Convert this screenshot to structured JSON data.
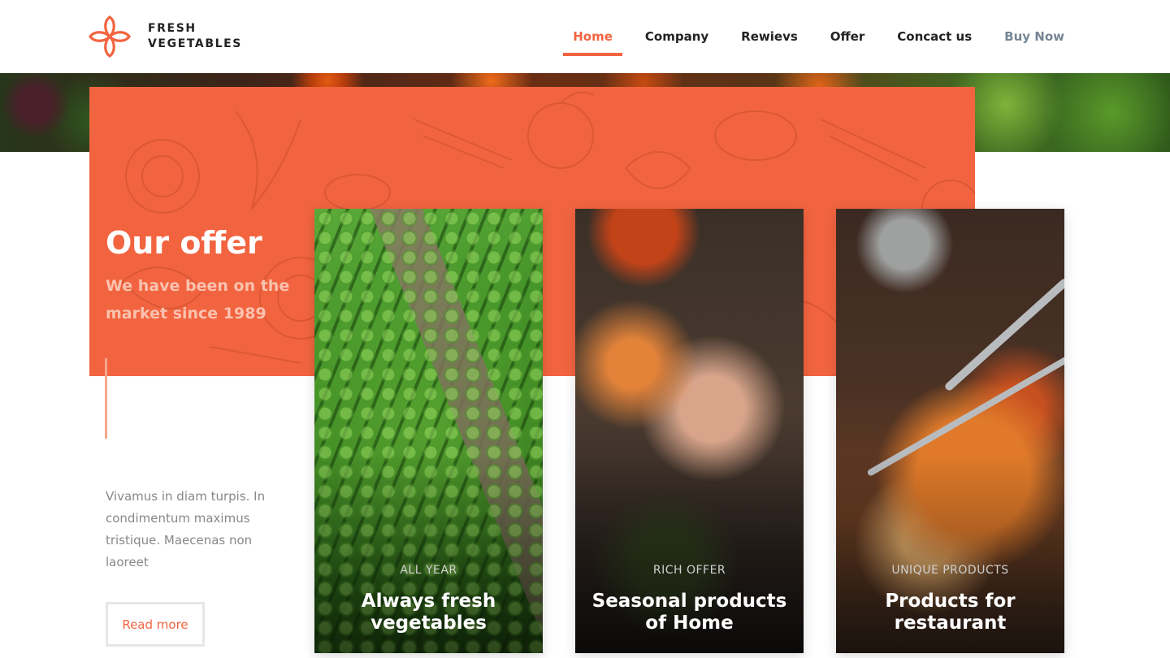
{
  "brand": {
    "name_line1": "FRESH",
    "name_line2": "VEGETABLES",
    "logo_icon": "flower-icon",
    "accent_color": "#f26440"
  },
  "nav": {
    "items": [
      {
        "label": "Home",
        "active": true
      },
      {
        "label": "Company",
        "active": false
      },
      {
        "label": "Rewievs",
        "active": false
      },
      {
        "label": "Offer",
        "active": false
      },
      {
        "label": "Concact us",
        "active": false
      },
      {
        "label": "Buy Now",
        "active": false
      }
    ]
  },
  "offer": {
    "title": "Our offer",
    "subtitle": "We have been on the market since 1989",
    "description": "Vivamus in diam turpis. In condimentum maximus tristique. Maecenas non laoreet",
    "read_more": "Read more"
  },
  "cards": [
    {
      "tag": "ALL YEAR",
      "title": "Always fresh vegetables"
    },
    {
      "tag": "RICH OFFER",
      "title": "Seasonal products of Home"
    },
    {
      "tag": "UNIQUE PRODUCTS",
      "title": "Products for restaurant"
    }
  ]
}
